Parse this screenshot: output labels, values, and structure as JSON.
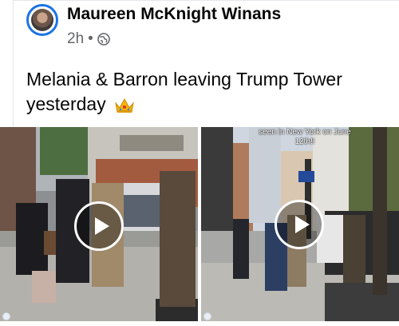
{
  "post": {
    "author": "Maureen McKnight Winans",
    "time": "2h",
    "separator": "•",
    "privacy_icon": "globe-icon",
    "text": "Melania & Barron leaving Trump Tower yesterday",
    "emoji_icon": "crown-icon"
  },
  "media": {
    "left_video": {
      "play_icon": "play-icon"
    },
    "right_video": {
      "caption_line1": "seen in New York on June",
      "caption_line2": "12th!!",
      "play_icon": "play-icon"
    }
  },
  "colors": {
    "accent": "#1b74e4",
    "text": "#050505",
    "meta": "#65676b"
  }
}
